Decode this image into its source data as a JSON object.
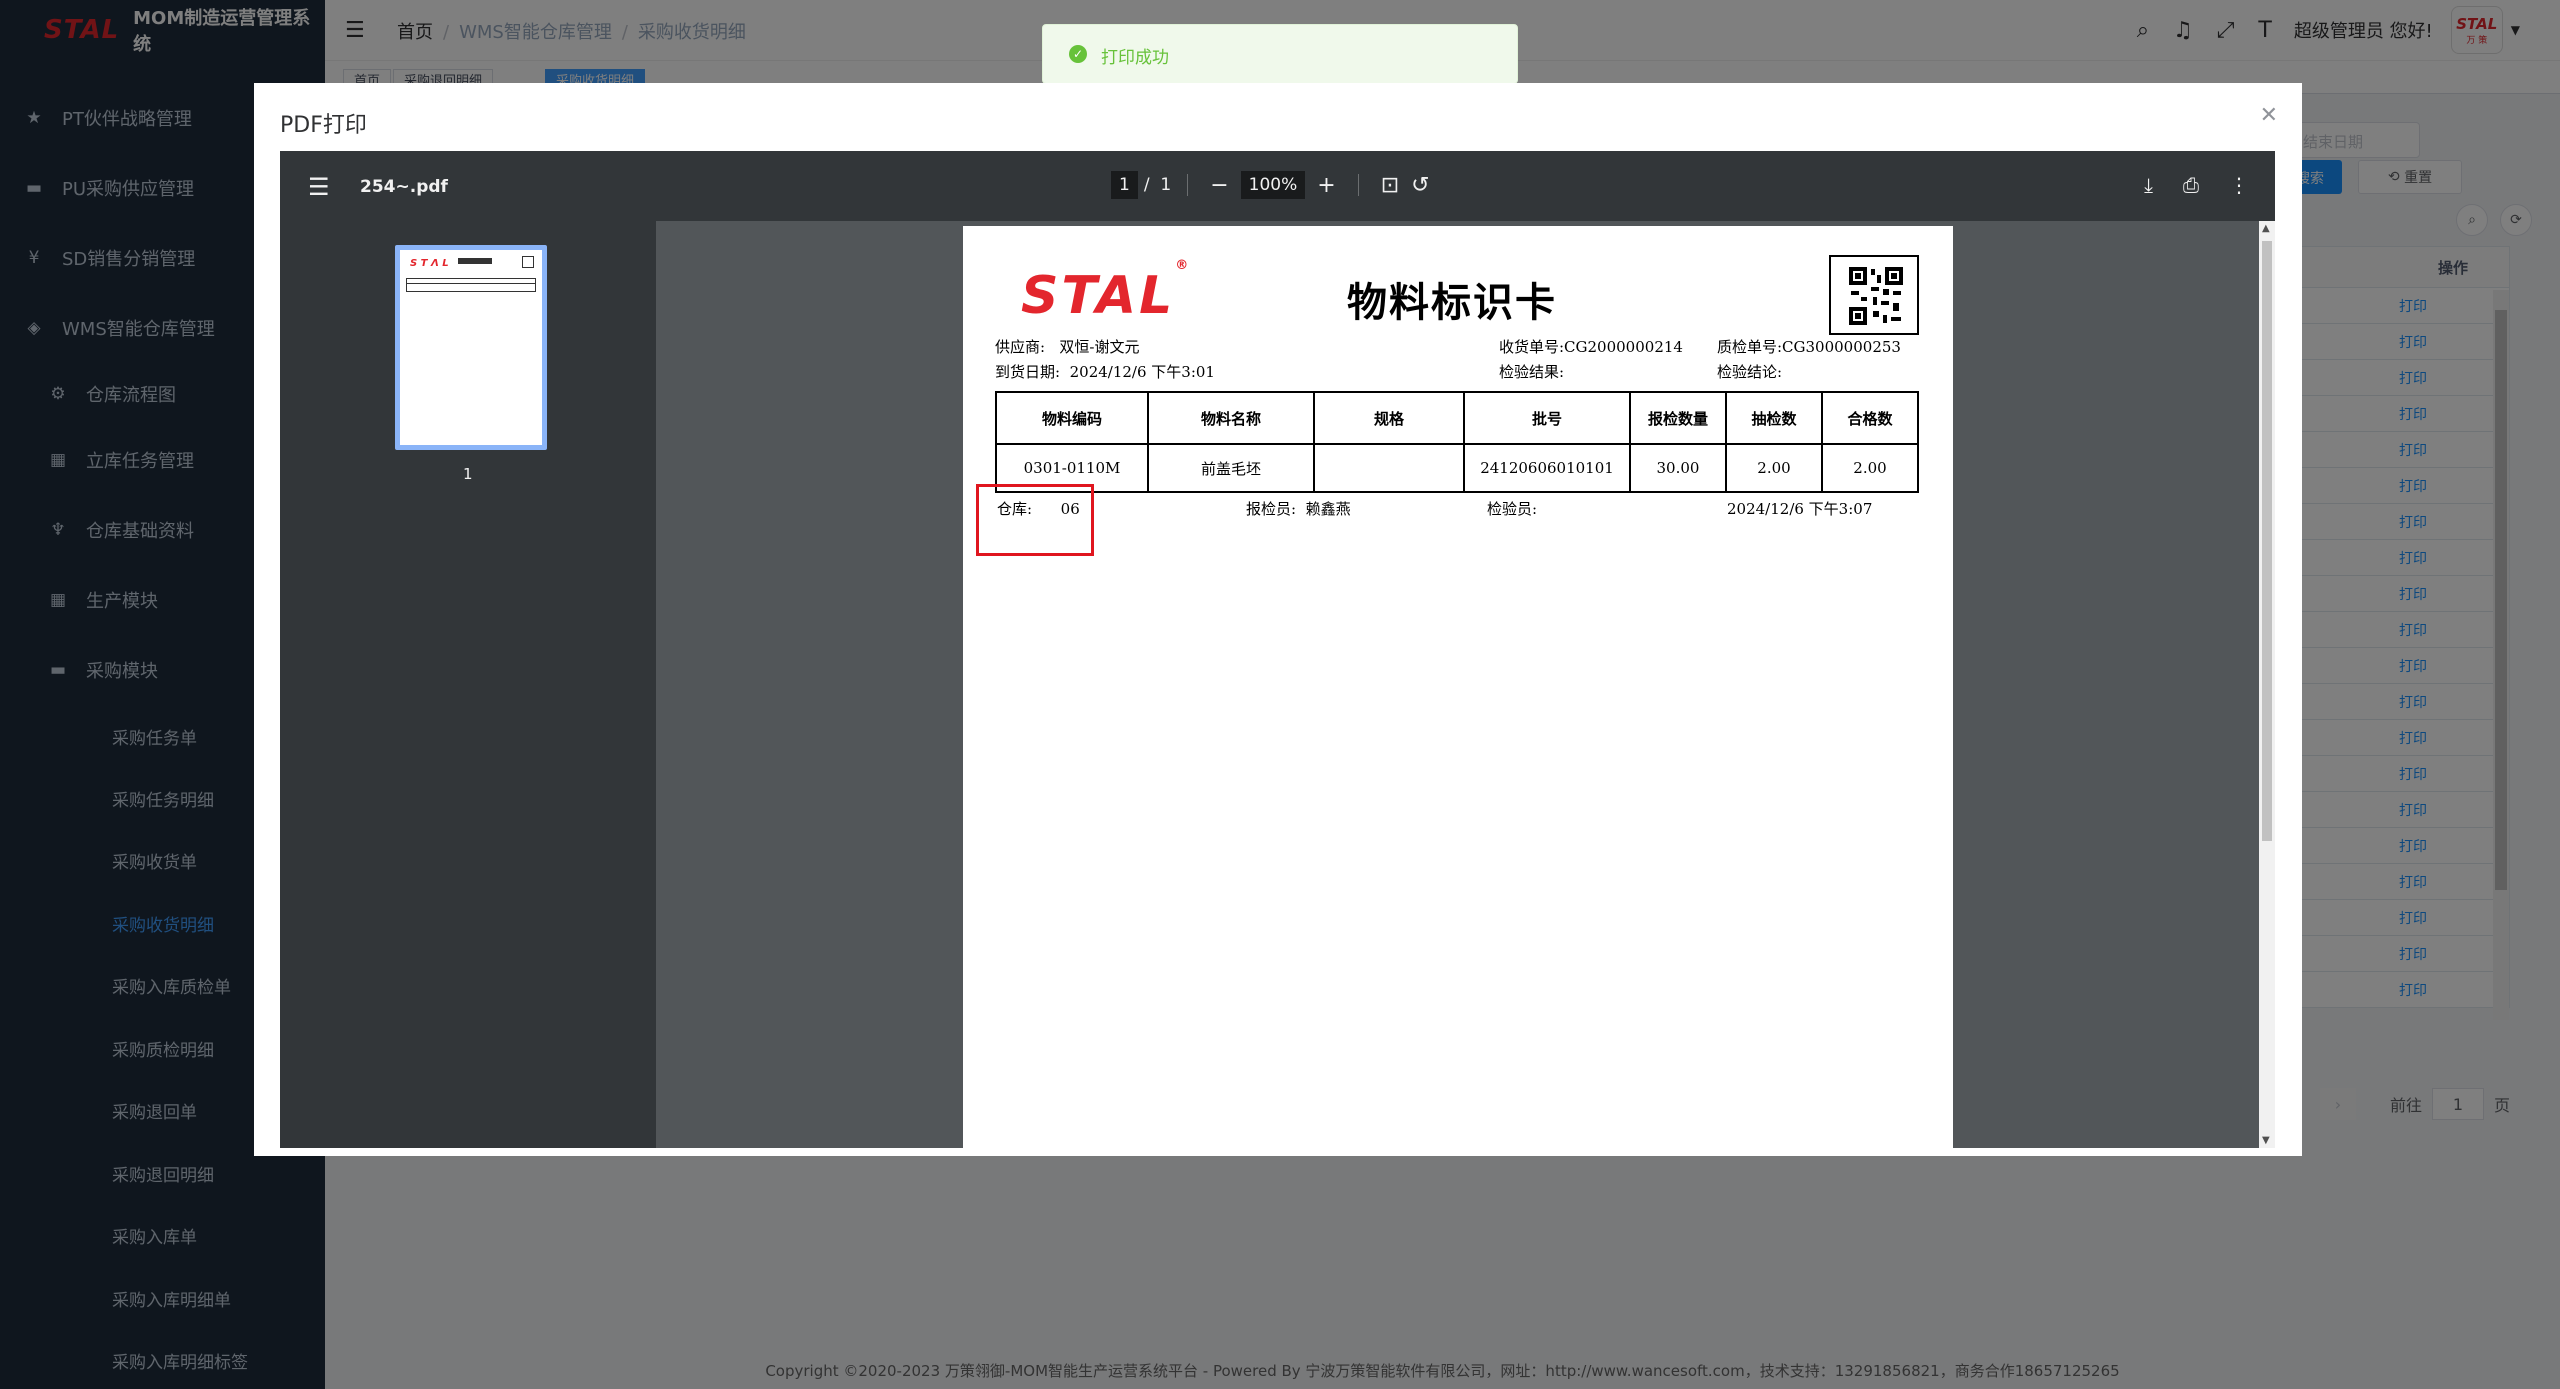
{
  "sidebar": {
    "logo": "STAL",
    "title": "MOM制造运营管理系统",
    "menu": [
      {
        "label": "PT伙伴战略管理",
        "icon": "star-icon"
      },
      {
        "label": "PU采购供应管理",
        "icon": "cart-icon"
      },
      {
        "label": "SD销售分销管理",
        "icon": "yen-icon"
      },
      {
        "label": "WMS智能仓库管理",
        "icon": "layers-icon"
      }
    ],
    "wms_sub": [
      {
        "label": "仓库流程图",
        "icon": "flow-icon"
      },
      {
        "label": "立库任务管理",
        "icon": "grid-icon"
      },
      {
        "label": "仓库基础资料",
        "icon": "settings-icon"
      },
      {
        "label": "生产模块",
        "icon": "grid-icon"
      },
      {
        "label": "采购模块",
        "icon": "cart-icon"
      }
    ],
    "purchase_sub": [
      "采购任务单",
      "采购任务明细",
      "采购收货单",
      "采购收货明细",
      "采购入库质检单",
      "采购质检明细",
      "采购退回单",
      "采购退回明细",
      "采购入库单",
      "采购入库明细单",
      "采购入库明细标签"
    ]
  },
  "navbar": {
    "breadcrumb": [
      "首页",
      "WMS智能仓库管理",
      "采购收货明细"
    ],
    "greeting": "超级管理员 您好!",
    "avatar_logo": "STAL",
    "avatar_sub": "万 策"
  },
  "tags": [
    "首页",
    "采购退回明细",
    "采购收货明细"
  ],
  "background": {
    "date_placeholder": "结束日期",
    "search_label": "搜索",
    "reset_label": "重置",
    "col_header": "操作",
    "row_action": "打印",
    "pager_prefix": "前往",
    "pager_value": "1",
    "pager_suffix": "页"
  },
  "footer": "Copyright ©2020-2023 万策翎御-MOM智能生产运营系统平台 - Powered By 宁波万策智能软件有限公司，网址：http://www.wancesoft.com，技术支持：13291856821，商务合作18657125265",
  "toast": "打印成功",
  "dialog": {
    "title": "PDF打印",
    "viewer": {
      "file_name": "254~.pdf",
      "page_current": "1",
      "page_total": "1",
      "zoom": "100%",
      "thumb_label": "1"
    },
    "doc": {
      "logo": "STAL",
      "title": "物料标识卡",
      "supplier_label": "供应商:",
      "supplier": "双恒-谢文元",
      "arrival_label": "到货日期:",
      "arrival": "2024/12/6 下午3:01",
      "receipt_no": "收货单号:CG2000000214",
      "qc_no": "质检单号:CG3000000253",
      "inspect_result": "检验结果:",
      "inspect_conclusion": "检验结论:",
      "table": {
        "headers": [
          "物料编码",
          "物料名称",
          "规格",
          "批号",
          "报检数量",
          "抽检数",
          "合格数"
        ],
        "rows": [
          [
            "0301-0110M",
            "前盖毛坯",
            "",
            "24120606010101",
            "30.00",
            "2.00",
            "2.00"
          ]
        ]
      },
      "warehouse_label": "仓库:",
      "warehouse": "06",
      "reporter_label": "报检员:",
      "reporter": "赖鑫燕",
      "inspector_label": "检验员:",
      "print_time": "2024/12/6 下午3:07"
    }
  },
  "colors": {
    "accent": "#409eff",
    "brand_red": "#e3262d",
    "sidebar_bg": "#1f2d3d",
    "success": "#67c23a",
    "highlight": "#e0161f"
  }
}
